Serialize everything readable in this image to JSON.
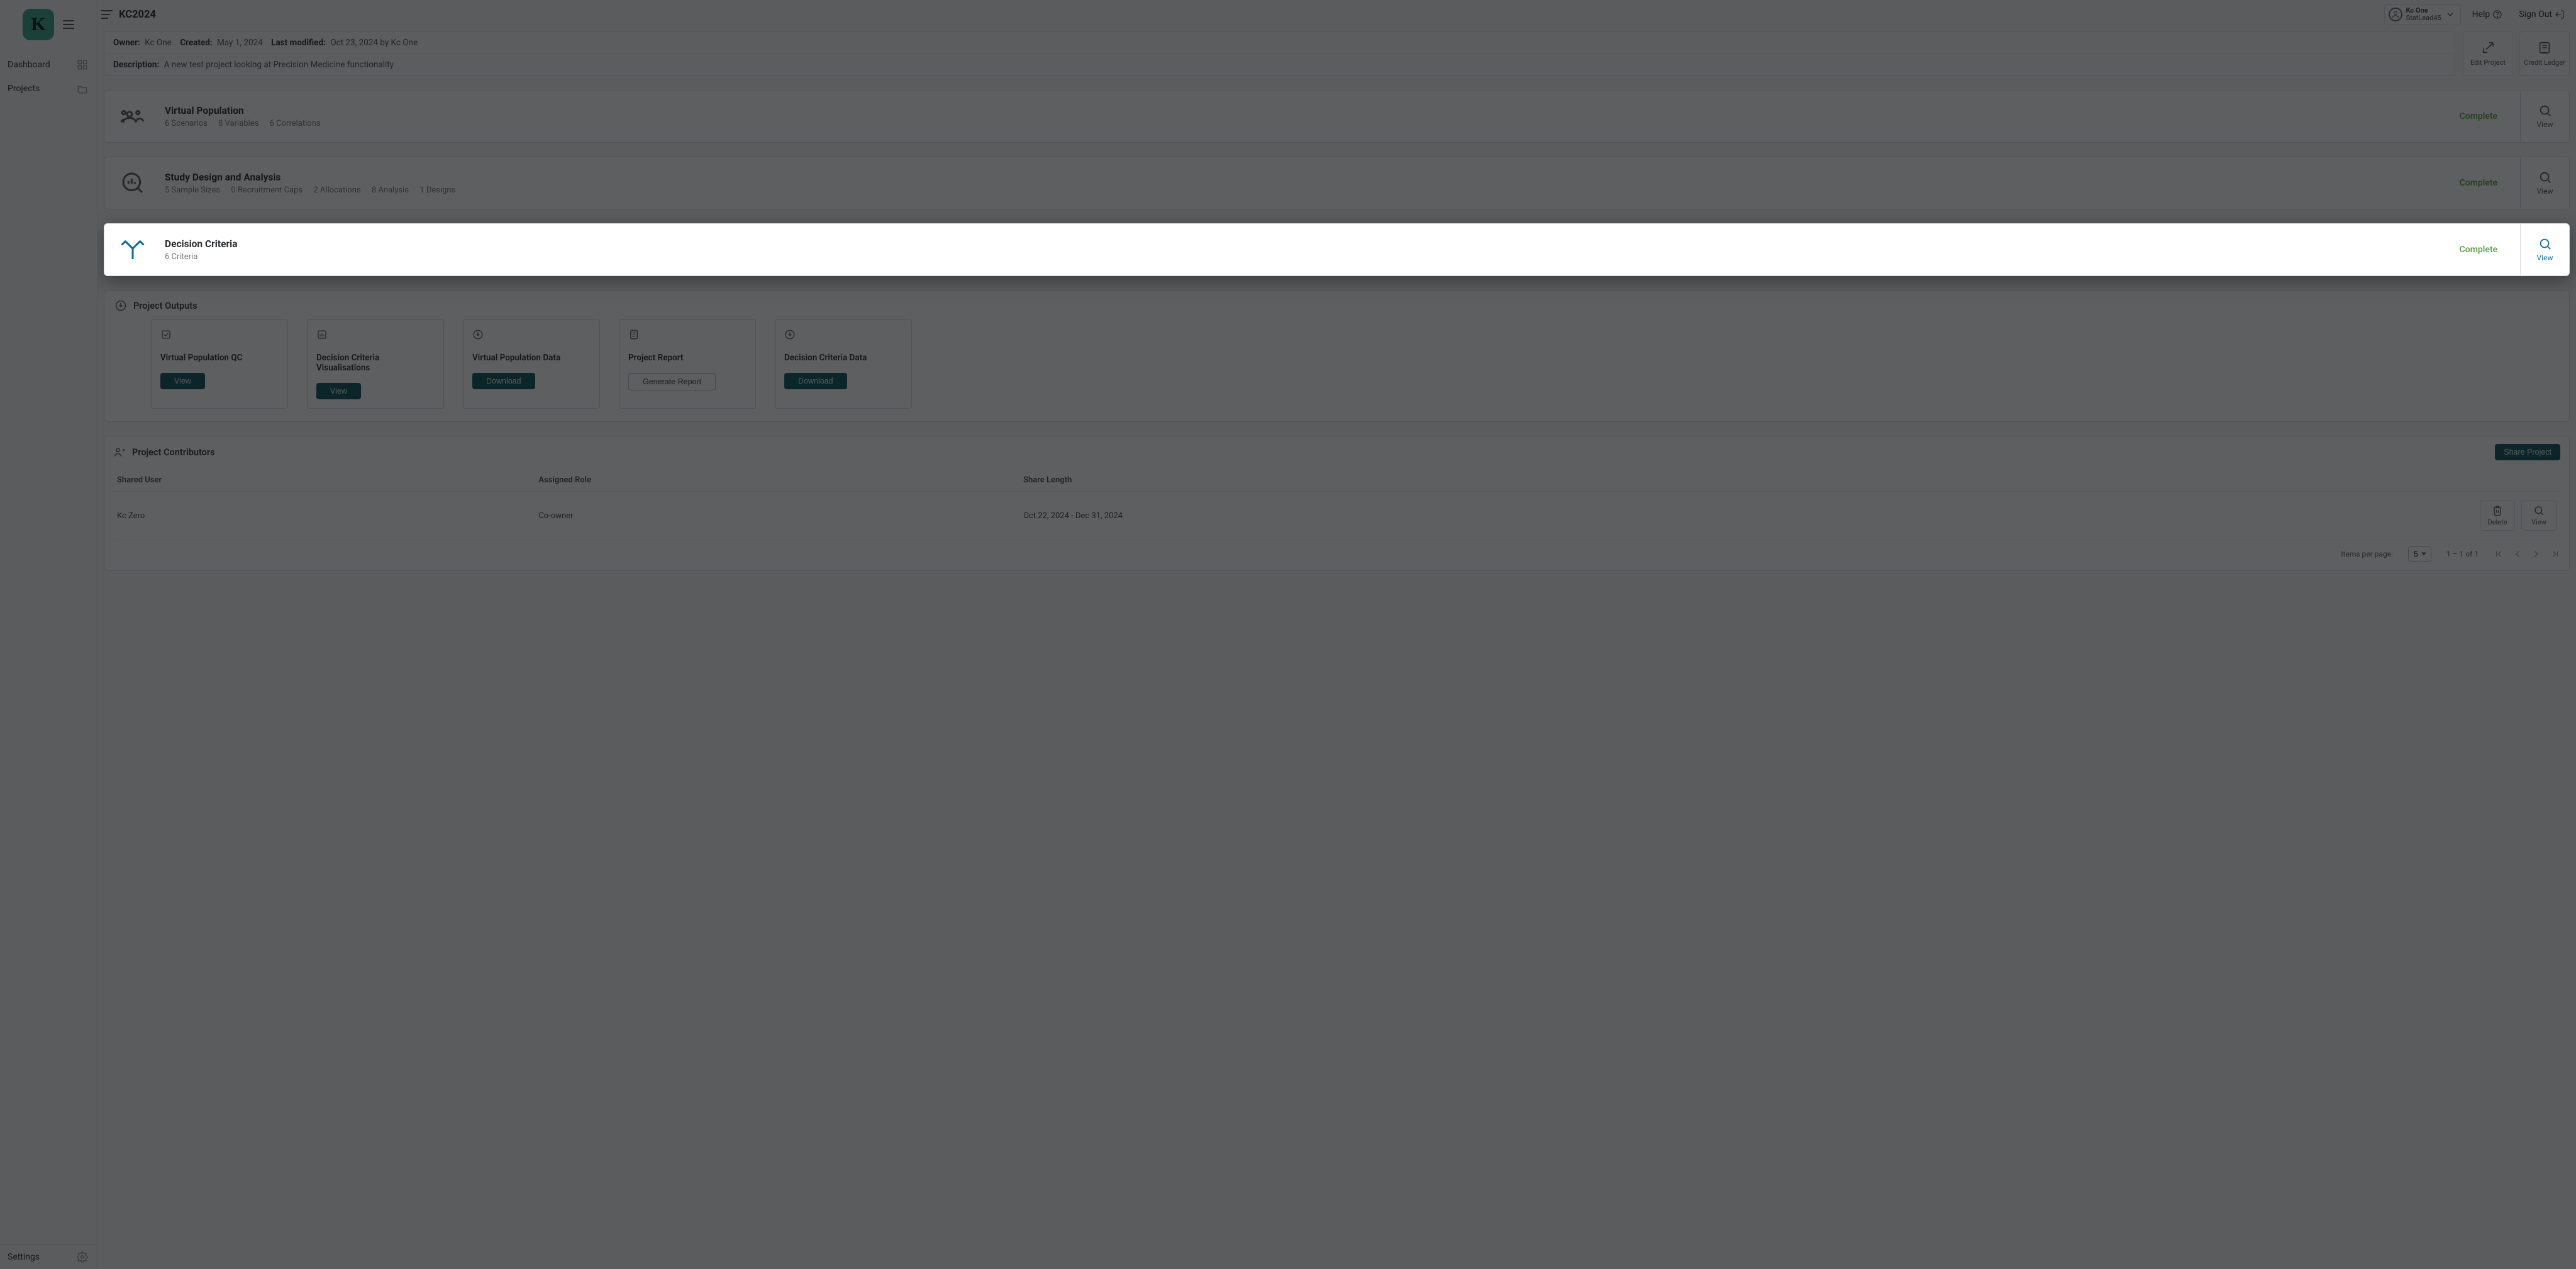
{
  "sidebar": {
    "items": [
      {
        "label": "Dashboard"
      },
      {
        "label": "Projects"
      }
    ],
    "settings_label": "Settings"
  },
  "topbar": {
    "title": "KC2024",
    "user": {
      "name": "Kc One",
      "role": "StatLead45"
    },
    "help": "Help",
    "signout": "Sign Out"
  },
  "meta": {
    "owner_label": "Owner:",
    "owner": "Kc One",
    "created_label": "Created:",
    "created": "May 1, 2024",
    "modified_label": "Last modified:",
    "modified": "Oct 23, 2024 by Kc One",
    "desc_label": "Description:",
    "desc": "A new test project looking at Precision Medicine functionality",
    "edit_btn": "Edit Project",
    "ledger_btn": "Credit Ledger"
  },
  "sections": {
    "vp": {
      "title": "Virtual Population",
      "sub": [
        "6 Scenarios",
        "8 Variables",
        "6 Correlations"
      ],
      "status": "Complete",
      "view": "View"
    },
    "sda": {
      "title": "Study Design and Analysis",
      "sub": [
        "5 Sample Sizes",
        "0 Recruitment Caps",
        "2 Allocations",
        "8 Analysis",
        "1 Designs"
      ],
      "status": "Complete",
      "view": "View"
    },
    "dc": {
      "title": "Decision Criteria",
      "sub": [
        "6 Criteria"
      ],
      "status": "Complete",
      "view": "View"
    }
  },
  "outputs": {
    "head": "Project Outputs",
    "cards": [
      {
        "title": "Virtual Population QC",
        "btn": "View",
        "style": "fill"
      },
      {
        "title": "Decision Criteria Visualisations",
        "btn": "View",
        "style": "fill"
      },
      {
        "title": "Virtual Population Data",
        "btn": "Download",
        "style": "fill"
      },
      {
        "title": "Project Report",
        "btn": "Generate Report",
        "style": "outline"
      },
      {
        "title": "Decision Criteria Data",
        "btn": "Download",
        "style": "fill"
      }
    ]
  },
  "contrib": {
    "head": "Project Contributors",
    "share_btn": "Share Project",
    "cols": [
      "Shared User",
      "Assigned Role",
      "Share Length",
      ""
    ],
    "rows": [
      {
        "user": "Kc Zero",
        "role": "Co-owner",
        "length": "Oct 22, 2024 - Dec 31, 2024"
      }
    ],
    "row_actions": {
      "delete": "Delete",
      "view": "View"
    }
  },
  "pager": {
    "label": "Items per page:",
    "size": "5",
    "range": "1 – 1 of 1"
  }
}
